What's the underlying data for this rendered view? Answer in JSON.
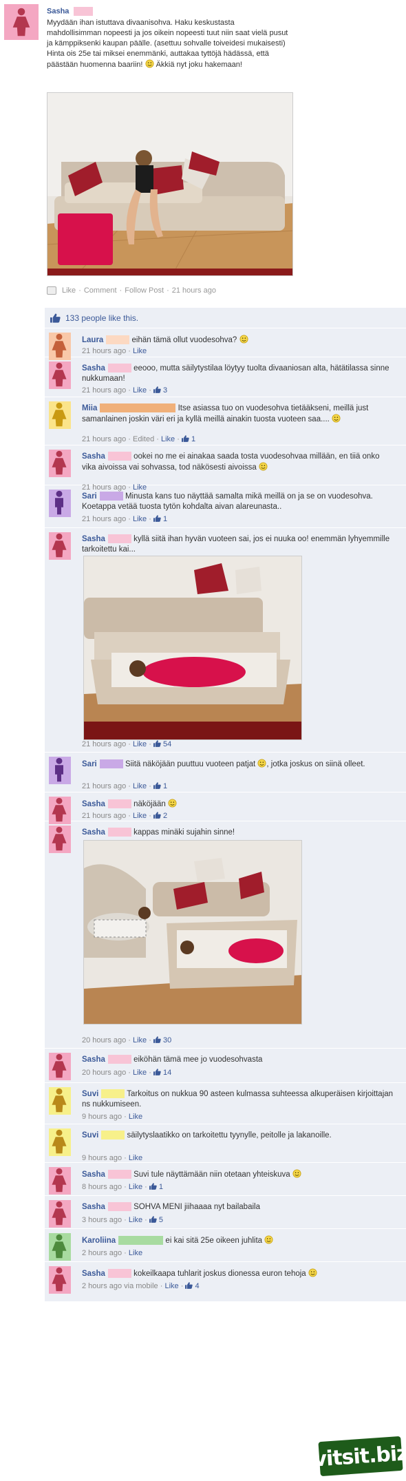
{
  "post": {
    "author": "Sasha",
    "author_color": "#f4a7c2",
    "text": "Myydään ihan istuttava divaanisohva. Haku keskustasta mahdollisimman nopeesti ja jos oikein nopeesti tuut niin saat vielä pusut ja kämppiksenki kaupan päälle. (asettuu sohvalle toiveidesi mukaisesti) Hinta ois 25e tai miksei enemmänki, auttakaa tyttöjä hädässä, että päästään huomenna baariin!",
    "text_tail": "Äkkiä nyt joku hakemaan!",
    "actions": {
      "like": "Like",
      "comment": "Comment",
      "follow": "Follow Post",
      "time": "21 hours ago"
    }
  },
  "likes": {
    "text": "133 people like this."
  },
  "comments": [
    {
      "name": "Laura",
      "gender": "female",
      "avatar_color": "#f9c8a8",
      "mask_color": "#fcd9c2",
      "text": "eihän tämä ollut vuodesohva?",
      "smile": true,
      "meta": "21 hours ago",
      "like": "Like",
      "count": ""
    },
    {
      "name": "Sasha",
      "gender": "female",
      "avatar_color": "#f4a7c2",
      "mask_color": "#f8c4d6",
      "text": "eeooo, mutta säilytystilaa löytyy tuolta divaaniosan alta, hätätilassa sinne nukkumaan!",
      "smile": false,
      "meta": "21 hours ago",
      "like": "Like",
      "count": "3"
    },
    {
      "name": "Miia",
      "gender": "female",
      "avatar_color": "#fbe48a",
      "mask_color": "#f0b07a",
      "text": "Itse asiassa tuo on vuodesohva tietääkseni, meillä just samanlainen joskin väri eri ja kyllä meillä ainakin tuosta vuoteen saa....",
      "smile": true,
      "meta": "21 hours ago",
      "edited": "Edited",
      "like": "Like",
      "count": "1"
    },
    {
      "name": "Sasha",
      "gender": "female",
      "avatar_color": "#f4a7c2",
      "mask_color": "#f8c4d6",
      "text": "ookei no me ei ainakaa saada tosta vuodesohvaa millään, en tiiä onko vika aivoissa vai sohvassa, tod näkösesti aivoissa",
      "smile": true,
      "meta": "21 hours ago",
      "like": "Like",
      "count": ""
    },
    {
      "name": "Sari",
      "gender": "male",
      "avatar_color": "#c9a9e6",
      "mask_color": "#c9a9e6",
      "text": "Minusta kans tuo näyttää samalta mikä meillä on ja se on vuodesohva. Koetappa vetää tuosta tytön kohdalta aivan alareunasta..",
      "smile": false,
      "meta": "21 hours ago",
      "like": "Like",
      "count": "1"
    },
    {
      "name": "Sasha",
      "gender": "female",
      "avatar_color": "#f4a7c2",
      "mask_color": "#f8c4d6",
      "text": "kyllä siitä ihan hyvän vuoteen sai, jos ei nuuka oo! enemmän lyhyemmille tarkoitettu kai...",
      "smile": false,
      "photo": "sofa-bed-open",
      "meta": "21 hours ago",
      "like": "Like",
      "count": "54"
    },
    {
      "name": "Sari",
      "gender": "male",
      "avatar_color": "#c9a9e6",
      "mask_color": "#c9a9e6",
      "text": "Siitä näköjään puuttuu vuoteen patjat",
      "text_after": ", jotka joskus on siinä olleet.",
      "smile": true,
      "meta": "21 hours ago",
      "like": "Like",
      "count": "1"
    },
    {
      "name": "Sasha",
      "gender": "female",
      "avatar_color": "#f4a7c2",
      "mask_color": "#f8c4d6",
      "text": "näköjään",
      "smile": true,
      "meta": "21 hours ago",
      "like": "Like",
      "count": "2"
    },
    {
      "name": "Sasha",
      "gender": "female",
      "avatar_color": "#f4a7c2",
      "mask_color": "#f8c4d6",
      "text": "kappas minäki sujahin sinne!",
      "smile": false,
      "photo": "sofa-bed-two",
      "meta": "20 hours ago",
      "like": "Like",
      "count": "30"
    },
    {
      "name": "Sasha",
      "gender": "female",
      "avatar_color": "#f4a7c2",
      "mask_color": "#f8c4d6",
      "text": "eiköhän tämä mee jo vuodesohvasta",
      "smile": false,
      "meta": "20 hours ago",
      "like": "Like",
      "count": "14"
    },
    {
      "name": "Suvi",
      "gender": "female",
      "avatar_color": "#f7f08a",
      "mask_color": "#f7f08a",
      "text": "Tarkoitus on nukkua 90 asteen kulmassa suhteessa alkuperäisen kirjoittajan ns nukkumiseen.",
      "smile": false,
      "meta": "9 hours ago",
      "like": "Like",
      "count": ""
    },
    {
      "name": "Suvi",
      "gender": "female",
      "avatar_color": "#f7f08a",
      "mask_color": "#f7f08a",
      "text": "säilytyslaatikko on tarkoitettu tyynylle, peitolle ja lakanoille.",
      "smile": false,
      "meta": "9 hours ago",
      "like": "Like",
      "count": ""
    },
    {
      "name": "Sasha",
      "gender": "female",
      "avatar_color": "#f4a7c2",
      "mask_color": "#f8c4d6",
      "text": "Suvi tule näyttämään niin otetaan yhteiskuva",
      "smile": true,
      "meta": "8 hours ago",
      "like": "Like",
      "count": "1"
    },
    {
      "name": "Sasha",
      "gender": "female",
      "avatar_color": "#f4a7c2",
      "mask_color": "#f8c4d6",
      "text": "SOHVA MENI jiihaaaa nyt bailabaila",
      "smile": false,
      "meta": "3 hours ago",
      "like": "Like",
      "count": "5"
    },
    {
      "name": "Karoliina",
      "gender": "female",
      "avatar_color": "#a8dba0",
      "mask_color": "#a8dba0",
      "text": "ei kai sitä 25e oikeen juhlita",
      "smile": true,
      "meta": "2 hours ago",
      "like": "Like",
      "count": ""
    },
    {
      "name": "Sasha",
      "gender": "female",
      "avatar_color": "#f4a7c2",
      "mask_color": "#f8c4d6",
      "text": "kokeilkaapa tuhlarit joskus dionessa euron tehoja",
      "smile": true,
      "meta": "2 hours ago via mobile",
      "like": "Like",
      "count": "4"
    }
  ],
  "watermark": "vitsit.biz"
}
